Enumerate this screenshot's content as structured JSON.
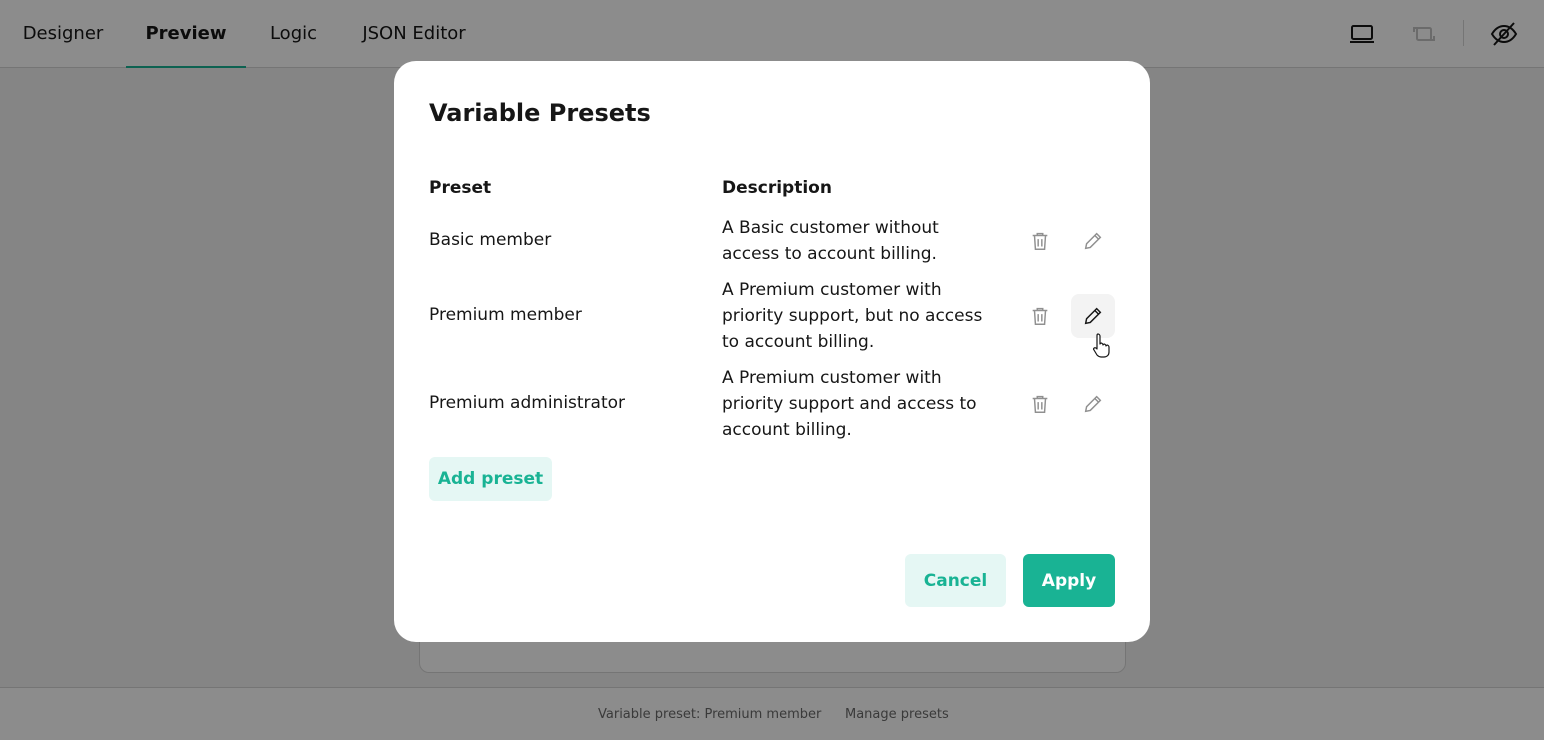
{
  "tabs": [
    {
      "label": "Designer"
    },
    {
      "label": "Preview"
    },
    {
      "label": "Logic"
    },
    {
      "label": "JSON Editor"
    }
  ],
  "active_tab": "Preview",
  "toolbar_icons": [
    "laptop-icon",
    "rotate-device-icon",
    "eye-off-icon"
  ],
  "status": {
    "variable_preset": "Variable preset: Premium member",
    "manage_presets": "Manage presets"
  },
  "modal": {
    "title": "Variable Presets",
    "col_preset": "Preset",
    "col_description": "Description",
    "presets": [
      {
        "name": "Basic member",
        "description": "A Basic customer without access to account billing."
      },
      {
        "name": "Premium member",
        "description": "A Premium customer with priority support, but no access to account billing."
      },
      {
        "name": "Premium administrator",
        "description": "A Premium customer with priority support and access to account billing."
      }
    ],
    "add_label": "Add preset",
    "cancel_label": "Cancel",
    "apply_label": "Apply"
  },
  "colors": {
    "accent": "#19b394",
    "accent_light": "#e5f7f4",
    "text": "#161616",
    "muted_icon": "#909090"
  }
}
